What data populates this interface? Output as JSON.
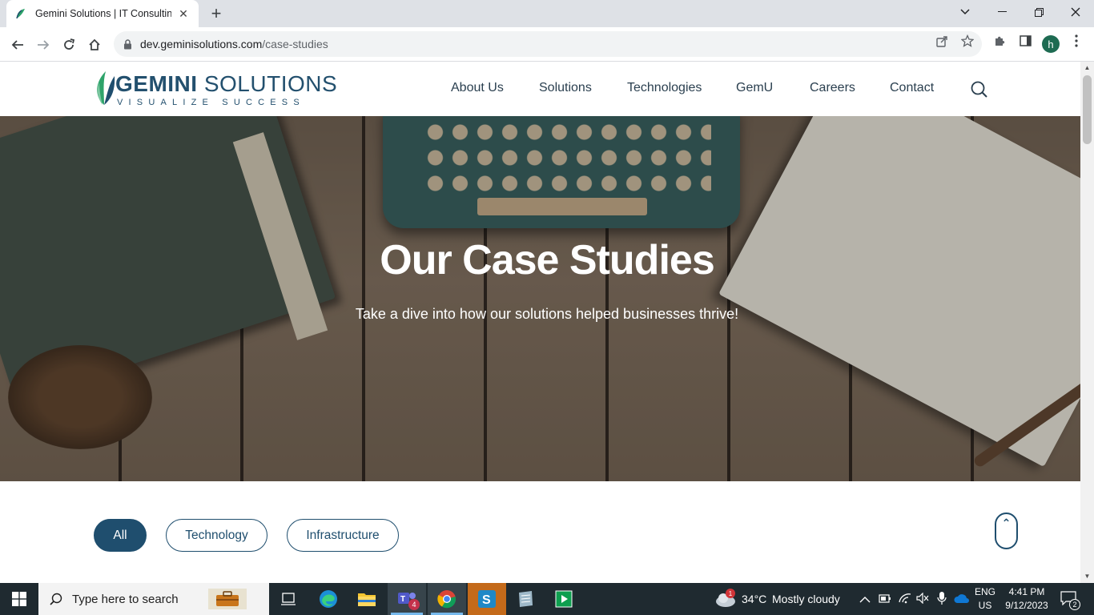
{
  "browser": {
    "tab_title": "Gemini Solutions | IT Consulting,",
    "url_host": "dev.geminisolutions.com",
    "url_path": "/case-studies",
    "profile_initial": "h"
  },
  "site": {
    "logo": {
      "word_bold": "GEMINI",
      "word_light": " SOLUTIONS",
      "tagline": "VISUALIZE SUCCESS"
    },
    "nav": [
      "About Us",
      "Solutions",
      "Technologies",
      "GemU",
      "Careers",
      "Contact"
    ]
  },
  "hero": {
    "title": "Our Case Studies",
    "subtitle": "Take a dive into how our solutions helped businesses thrive!"
  },
  "filters": [
    "All",
    "Technology",
    "Infrastructure"
  ],
  "taskbar": {
    "search_placeholder": "Type here to search",
    "weather_temp": "34°C",
    "weather_desc": "Mostly cloudy",
    "lang_top": "ENG",
    "lang_bottom": "US",
    "time": "4:41 PM",
    "date": "9/12/2023",
    "notification_count": "2",
    "teams_badge": "4",
    "weather_badge": "1"
  },
  "colors": {
    "brand": "#1f4e6e",
    "taskbar": "#1f2a30",
    "accent_green": "#2ea36a"
  }
}
